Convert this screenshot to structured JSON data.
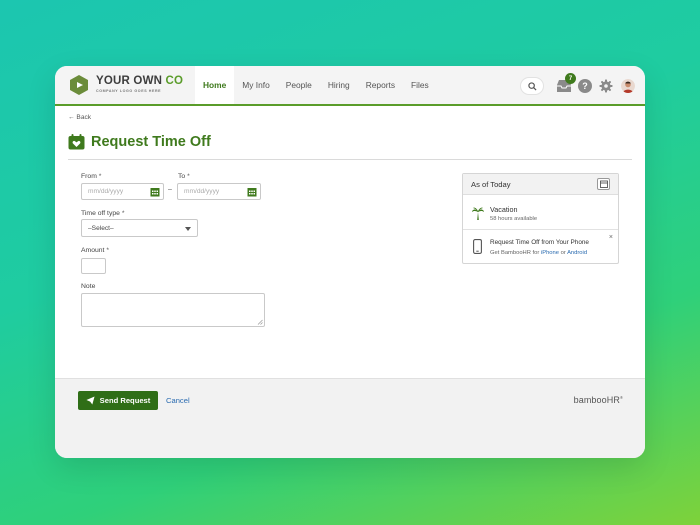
{
  "brand": {
    "logo_name_1": "YOUR OWN ",
    "logo_name_2": "CO",
    "logo_tagline": "COMPANY LOGO GOES HERE"
  },
  "nav": {
    "items": [
      "Home",
      "My Info",
      "People",
      "Hiring",
      "Reports",
      "Files"
    ],
    "active": "Home"
  },
  "header_icons": {
    "inbox_count": "7",
    "help_label": "?"
  },
  "page": {
    "back_label": "← Back",
    "title": "Request Time Off"
  },
  "form": {
    "from_label": "From",
    "to_label": "To",
    "required_mark": "*",
    "from_placeholder": "mm/dd/yyyy",
    "to_placeholder": "mm/dd/yyyy",
    "range_separator": "–",
    "type_label": "Time off type",
    "type_value": "–Select–",
    "amount_label": "Amount",
    "note_label": "Note"
  },
  "panel": {
    "heading": "As of Today",
    "vacation_name": "Vacation",
    "vacation_hours": "58 hours available",
    "phone_title": "Request Time Off from Your Phone",
    "phone_text": "Get BambooHR for",
    "phone_link_ios": "iPhone",
    "phone_or": "or",
    "phone_link_android": "Android",
    "close": "×"
  },
  "footer": {
    "send_label": "Send Request",
    "cancel_label": "Cancel",
    "brand_text": "bambooHR"
  },
  "colors": {
    "accent": "#3f7a1d",
    "button": "#2f6e17",
    "link": "#2a6bb0"
  }
}
